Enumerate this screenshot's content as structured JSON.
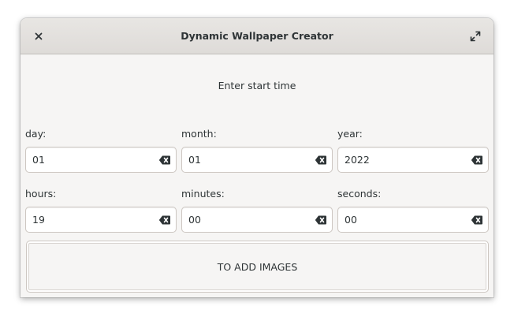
{
  "window": {
    "title": "Dynamic Wallpaper Creator",
    "close_icon": "close-icon",
    "maximize_icon": "maximize-icon"
  },
  "main": {
    "heading": "Enter start time",
    "fields": {
      "day": {
        "label": "day:",
        "value": "01"
      },
      "month": {
        "label": "month:",
        "value": "01"
      },
      "year": {
        "label": "year:",
        "value": "2022"
      },
      "hours": {
        "label": "hours:",
        "value": "19"
      },
      "minutes": {
        "label": "minutes:",
        "value": "00"
      },
      "seconds": {
        "label": "seconds:",
        "value": "00"
      }
    },
    "add_images_label": "TO ADD IMAGES"
  },
  "colors": {
    "window_bg": "#f6f5f4",
    "headerbar_bg": "#e1dedb",
    "text": "#2e3436",
    "border": "#cdc7c2"
  }
}
